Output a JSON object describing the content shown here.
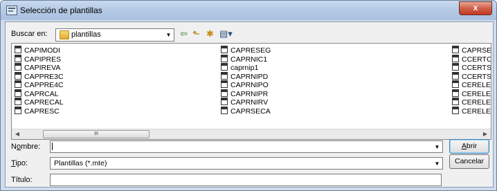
{
  "window": {
    "title": "Selección de plantillas",
    "close_label": "x"
  },
  "lookin": {
    "label": "Buscar en:",
    "value": "plantillas"
  },
  "files": {
    "col1": [
      "CAPIMODI",
      "CAPIPRES",
      "CAPIREVA",
      "CAPPRE3C",
      "CAPPRE4C",
      "CAPRCAL",
      "CAPRECAL",
      "CAPRESC"
    ],
    "col2": [
      "CAPRESEG",
      "CAPRNIC1",
      "caprnip1",
      "CAPRNIPD",
      "CAPRNIPO",
      "CAPRNIPR",
      "CAPRNIRV",
      "CAPRSECA"
    ],
    "col3": [
      "CAPRSEG",
      "CCERTCA",
      "CCERTSEC",
      "CCERTSEC",
      "CERELEMC",
      "CERELEMC",
      "CERELEMT",
      "CERELESB"
    ]
  },
  "scrollbar": {
    "thumb_grip": "III"
  },
  "nombre": {
    "label_prefix": "N",
    "label_underline": "o",
    "label_suffix": "mbre:",
    "value": ""
  },
  "tipo": {
    "label_underline": "T",
    "label_suffix": "ipo:",
    "value": "Plantillas (*.mte)"
  },
  "titulo": {
    "label": "Título:",
    "value": ""
  },
  "buttons": {
    "open_underline": "A",
    "open_suffix": "brir",
    "cancel": "Cancelar"
  }
}
